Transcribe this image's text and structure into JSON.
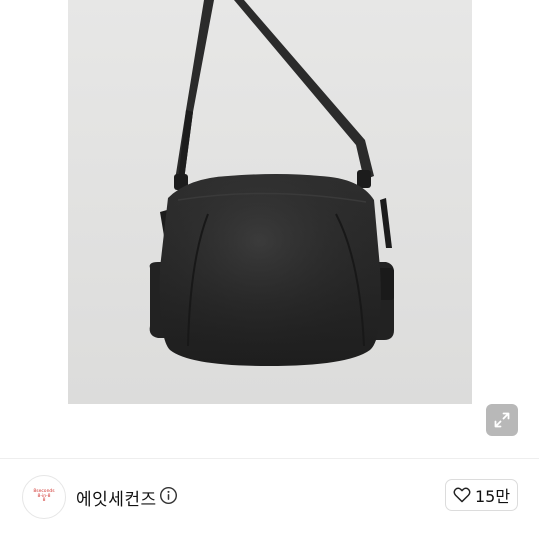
{
  "product": {
    "image_alt": "black leather shoulder bag",
    "expand_icon": "expand-icon"
  },
  "shop": {
    "name": "에잇세컨즈",
    "logo_text": [
      "8seconds",
      "8-in-8",
      "8"
    ],
    "info_icon": "info-icon"
  },
  "actions": {
    "like_count": "15만",
    "like_icon": "heart-outline-icon"
  },
  "colors": {
    "logo_red": "#d0312d",
    "image_background": "#e2e2e1",
    "bag": "#2a2a2a"
  }
}
